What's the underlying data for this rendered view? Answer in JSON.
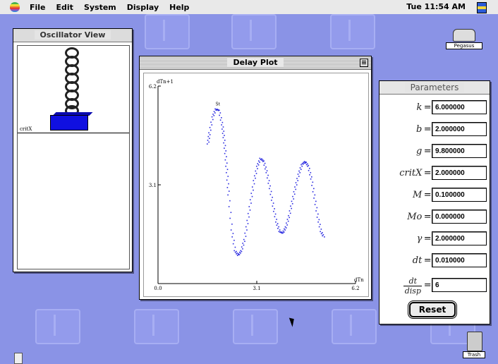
{
  "menubar": {
    "items": [
      "File",
      "Edit",
      "System",
      "Display",
      "Help"
    ],
    "clock": "Tue 11:54 AM"
  },
  "desktop": {
    "disk_label": "Pegasus",
    "trash_label": "Trash"
  },
  "oscillator_view": {
    "title": "Oscillator View",
    "critx_label": "critX"
  },
  "delay_plot": {
    "title": "Delay Plot",
    "chart_data": {
      "type": "scatter",
      "ylabel": "dTn+1",
      "xlabel": "dTn",
      "x_ticks": [
        "0.0",
        "3.1",
        "6.2"
      ],
      "y_ticks": [
        "0.0",
        "3.1",
        "6.2"
      ],
      "xlim": [
        0,
        6.2
      ],
      "ylim": [
        0,
        6.2
      ],
      "point_label": "St",
      "color": "#2a2ae0",
      "series": [
        {
          "x": [
            1.55,
            1.6,
            1.7,
            1.8,
            1.9,
            2.0,
            2.05,
            2.1,
            2.15,
            2.2,
            2.3,
            2.4,
            2.5,
            2.6,
            2.7,
            2.8,
            2.9,
            3.0,
            3.1,
            3.2,
            3.3,
            3.4,
            3.5,
            3.6,
            3.7,
            3.8,
            3.9,
            4.0,
            4.1,
            4.2,
            4.3,
            4.4,
            4.5,
            4.6,
            4.7,
            4.8,
            4.9,
            5.0,
            5.1,
            5.2
          ],
          "y": [
            4.4,
            4.75,
            5.25,
            5.5,
            5.45,
            5.0,
            4.6,
            4.1,
            3.5,
            2.8,
            1.7,
            1.05,
            0.9,
            1.05,
            1.4,
            2.0,
            2.65,
            3.25,
            3.7,
            3.95,
            3.85,
            3.5,
            3.0,
            2.45,
            1.95,
            1.65,
            1.6,
            1.8,
            2.15,
            2.6,
            3.05,
            3.45,
            3.75,
            3.85,
            3.7,
            3.3,
            2.7,
            2.1,
            1.65,
            1.45
          ]
        }
      ]
    }
  },
  "parameters": {
    "title": "Parameters",
    "rows": [
      {
        "label": "k",
        "value": "6.000000"
      },
      {
        "label": "b",
        "value": "2.000000"
      },
      {
        "label": "g",
        "value": "9.800000"
      },
      {
        "label": "critX",
        "value": "2.000000"
      },
      {
        "label": "M",
        "value": "0.100000"
      },
      {
        "label": "Mo",
        "value": "0.000000"
      },
      {
        "label": "γ",
        "value": "2.000000"
      },
      {
        "label": "dt",
        "value": "0.010000"
      }
    ],
    "frac_num": "dt",
    "frac_den": "disp",
    "frac_value": "6",
    "reset_label": "Reset"
  }
}
